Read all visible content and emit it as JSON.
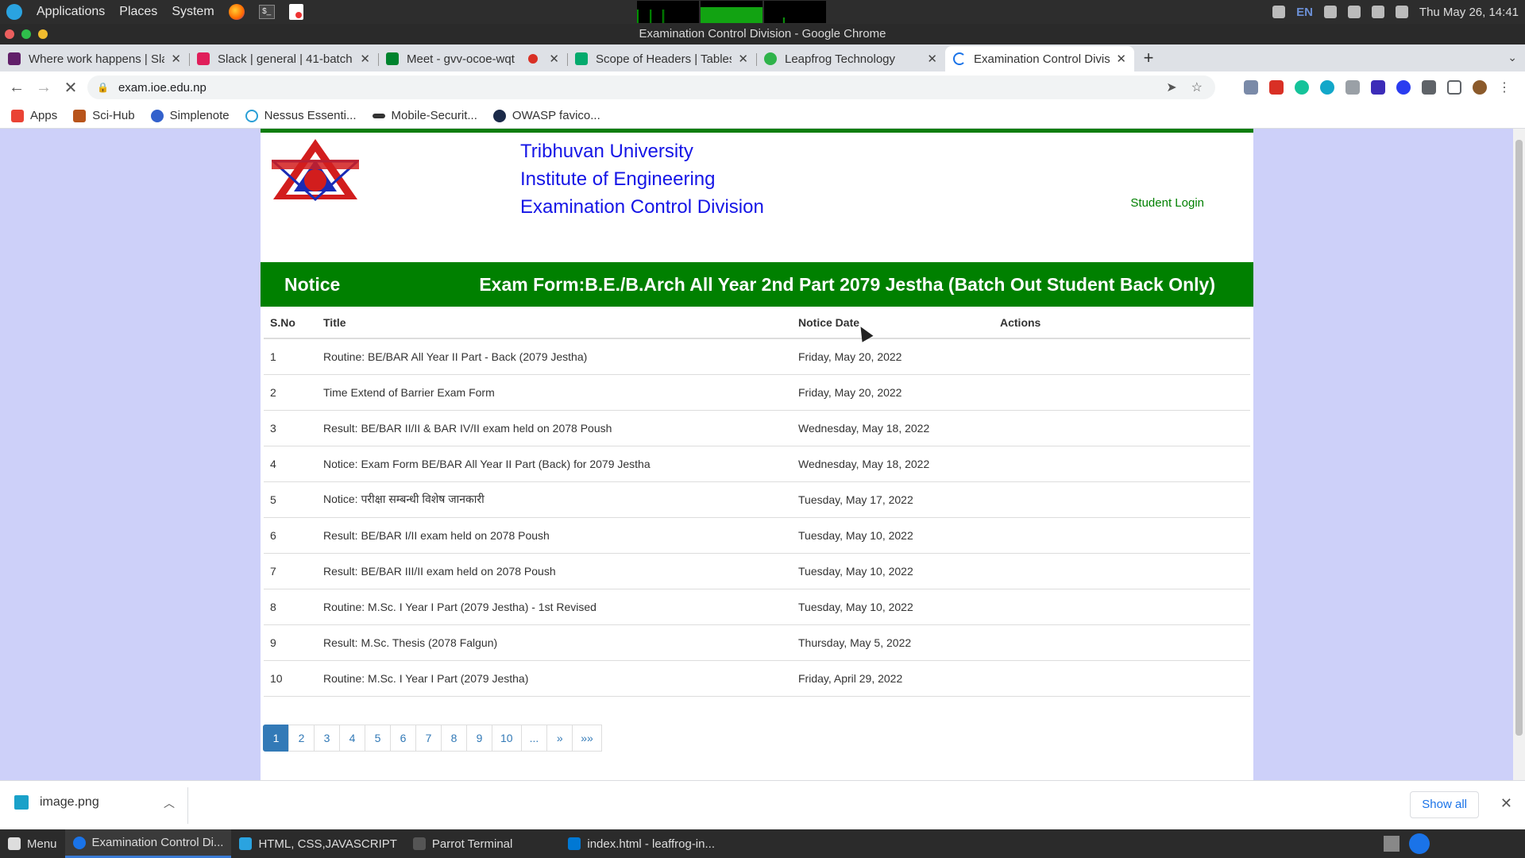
{
  "system_panel": {
    "menus": [
      "Applications",
      "Places",
      "System"
    ],
    "lang": "EN",
    "clock": "Thu May 26, 14:41"
  },
  "window": {
    "title": "Examination Control Division - Google Chrome"
  },
  "tabs": [
    {
      "label": "Where work happens | Sla",
      "color": "#611f69"
    },
    {
      "label": "Slack | general | 41-batch",
      "color": "#e01e5a"
    },
    {
      "label": "Meet - gvv-ocoe-wqt",
      "color": "#00832d"
    },
    {
      "label": "Scope of Headers | Tables",
      "color": "#04aa6d"
    },
    {
      "label": "Leapfrog Technology",
      "color": "#2fb34a"
    },
    {
      "label": "Examination Control Divis",
      "color": "#1a73e8"
    }
  ],
  "toolbar": {
    "url": "exam.ioe.edu.np"
  },
  "bookmarks": [
    {
      "label": "Apps",
      "color": "#ea4335"
    },
    {
      "label": "Sci-Hub",
      "color": "#b8541b"
    },
    {
      "label": "Simplenote",
      "color": "#3361cc"
    },
    {
      "label": "Nessus Essenti...",
      "color": "#2a9fd6"
    },
    {
      "label": "Mobile-Securit...",
      "color": "#333333"
    },
    {
      "label": "OWASP favico...",
      "color": "#1b2a49"
    }
  ],
  "site": {
    "university": "Tribhuvan University",
    "institute": "Institute of Engineering",
    "division": "Examination Control Division",
    "login": "Student Login",
    "notice_label": "Notice",
    "notice_title": "Exam Form:B.E./B.Arch All Year 2nd Part 2079 Jestha (Batch Out Student Back Only)",
    "columns": [
      "S.No",
      "Title",
      "Notice Date",
      "Actions"
    ],
    "rows": [
      {
        "sno": "1",
        "title": "Routine: BE/BAR All Year II Part - Back (2079 Jestha)",
        "date": "Friday, May 20, 2022"
      },
      {
        "sno": "2",
        "title": "Time Extend of Barrier Exam Form",
        "date": "Friday, May 20, 2022"
      },
      {
        "sno": "3",
        "title": "Result: BE/BAR II/II & BAR IV/II exam held on 2078 Poush",
        "date": "Wednesday, May 18, 2022"
      },
      {
        "sno": "4",
        "title": "Notice: Exam Form BE/BAR All Year II Part (Back) for 2079 Jestha",
        "date": "Wednesday, May 18, 2022"
      },
      {
        "sno": "5",
        "title": "Notice: परीक्षा सम्बन्धी विशेष जानकारी",
        "date": "Tuesday, May 17, 2022"
      },
      {
        "sno": "6",
        "title": "Result: BE/BAR I/II exam held on 2078 Poush",
        "date": "Tuesday, May 10, 2022"
      },
      {
        "sno": "7",
        "title": "Result: BE/BAR III/II exam held on 2078 Poush",
        "date": "Tuesday, May 10, 2022"
      },
      {
        "sno": "8",
        "title": "Routine: M.Sc. I Year I Part (2079 Jestha) - 1st Revised",
        "date": "Tuesday, May 10, 2022"
      },
      {
        "sno": "9",
        "title": "Result: M.Sc. Thesis (2078 Falgun)",
        "date": "Thursday, May 5, 2022"
      },
      {
        "sno": "10",
        "title": "Routine: M.Sc. I Year I Part (2079 Jestha)",
        "date": "Friday, April 29, 2022"
      }
    ],
    "pagination": [
      "1",
      "2",
      "3",
      "4",
      "5",
      "6",
      "7",
      "8",
      "9",
      "10",
      "...",
      "»",
      "»»"
    ],
    "current_page": "1"
  },
  "downloads": {
    "file": "image.png",
    "show_all": "Show all"
  },
  "taskbar": {
    "menu": "Menu",
    "items": [
      {
        "label": "Examination Control Di...",
        "color": "#1a73e8"
      },
      {
        "label": "HTML, CSS,JAVASCRIPT",
        "color": "#2aa3e0"
      },
      {
        "label": "Parrot Terminal",
        "color": "#555555"
      },
      {
        "label": "index.html - leaffrog-in...",
        "color": "#0078d4"
      }
    ]
  }
}
